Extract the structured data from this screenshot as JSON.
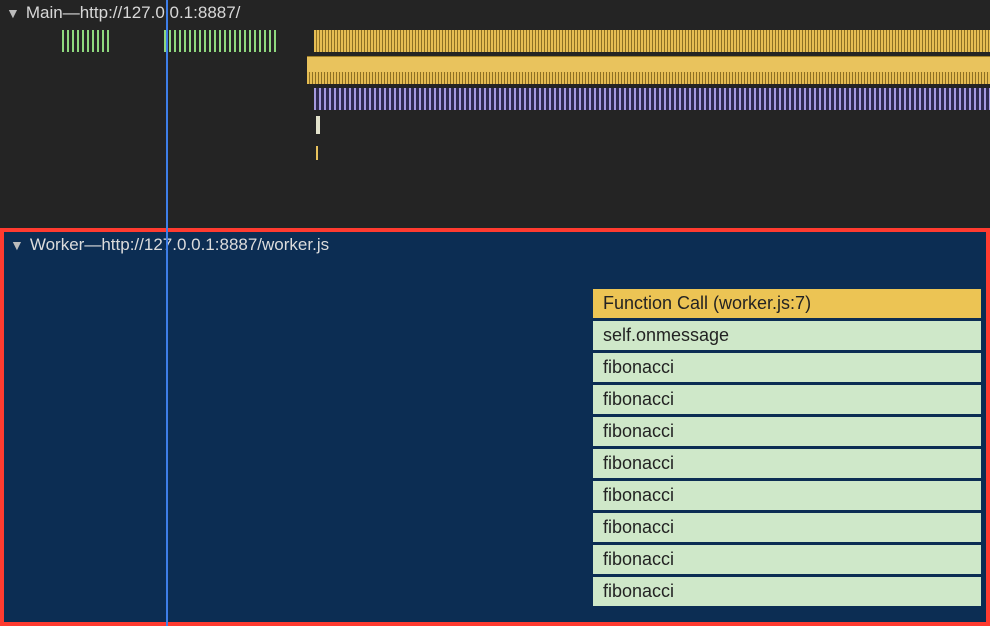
{
  "main": {
    "header_prefix": "Main",
    "header_sep": " — ",
    "header_url": "http://127.0.0.1:8887/"
  },
  "worker": {
    "header_prefix": "Worker",
    "header_sep": " — ",
    "header_url": "http://127.0.0.1:8887/worker.js"
  },
  "flame": {
    "rows": [
      {
        "label": "Function Call (worker.js:7)",
        "color": "yellow"
      },
      {
        "label": "self.onmessage",
        "color": "green"
      },
      {
        "label": "fibonacci",
        "color": "green"
      },
      {
        "label": "fibonacci",
        "color": "green"
      },
      {
        "label": "fibonacci",
        "color": "green"
      },
      {
        "label": "fibonacci",
        "color": "green"
      },
      {
        "label": "fibonacci",
        "color": "green"
      },
      {
        "label": "fibonacci",
        "color": "green"
      },
      {
        "label": "fibonacci",
        "color": "green"
      },
      {
        "label": "fibonacci",
        "color": "green"
      }
    ]
  },
  "icons": {
    "disclosure": "▼"
  }
}
